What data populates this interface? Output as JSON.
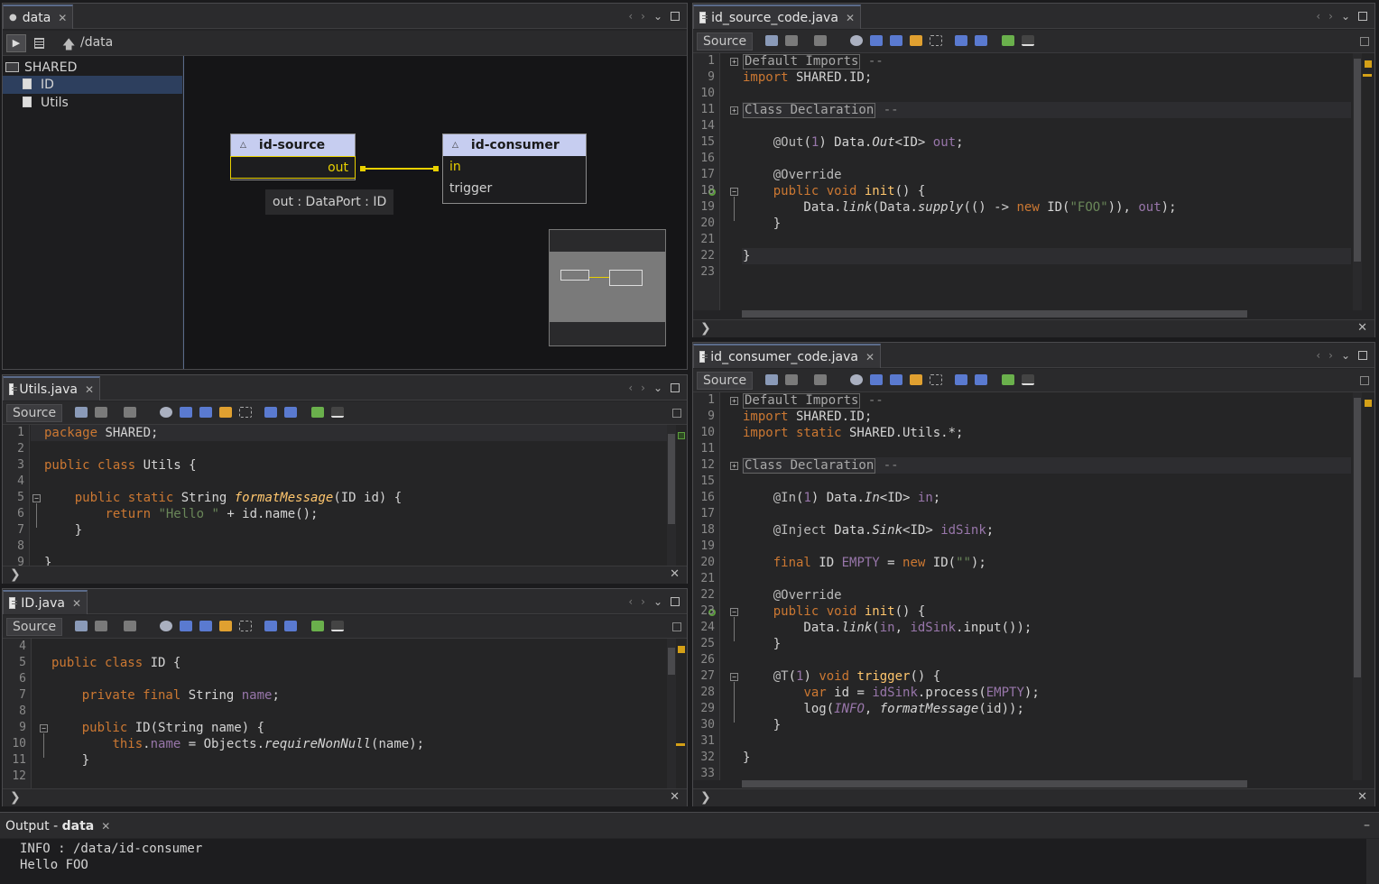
{
  "data_panel": {
    "tab_label": "data",
    "breadcrumb": "/data",
    "tree": {
      "root": "SHARED",
      "items": [
        "ID",
        "Utils"
      ]
    },
    "graph": {
      "source_node": {
        "title": "id-source",
        "ports": [
          "out"
        ]
      },
      "consumer_node": {
        "title": "id-consumer",
        "ports": [
          "in",
          "trigger"
        ]
      },
      "tooltip": "out : DataPort : ID"
    }
  },
  "utils_editor": {
    "tab_label": "Utils.java",
    "source_label": "Source",
    "lines": [
      {
        "n": "1",
        "html": "<span class=\"kw\">package</span> SHARED;"
      },
      {
        "n": "2",
        "html": ""
      },
      {
        "n": "3",
        "html": "<span class=\"kw\">public class</span> Utils {"
      },
      {
        "n": "4",
        "html": ""
      },
      {
        "n": "5",
        "html": "    <span class=\"kw\">public static</span> String <span class=\"fn\">formatMessage</span>(ID id) {"
      },
      {
        "n": "6",
        "html": "        <span class=\"kw\">return</span> <span class=\"str\">\"Hello \"</span> + id.name();"
      },
      {
        "n": "7",
        "html": "    }"
      },
      {
        "n": "8",
        "html": ""
      },
      {
        "n": "9",
        "html": "}"
      }
    ]
  },
  "id_editor": {
    "tab_label": "ID.java",
    "source_label": "Source",
    "lines": [
      {
        "n": "4",
        "html": ""
      },
      {
        "n": "5",
        "html": "<span class=\"kw\">public class</span> ID {"
      },
      {
        "n": "6",
        "html": ""
      },
      {
        "n": "7",
        "html": "    <span class=\"kw\">private final</span> String <span class=\"fld\">name</span>;"
      },
      {
        "n": "8",
        "html": ""
      },
      {
        "n": "9",
        "html": "    <span class=\"kw\">public</span> ID(String name) {"
      },
      {
        "n": "10",
        "html": "        <span class=\"kw\">this</span>.<span class=\"fld\">name</span> = Objects.<span class=\"it\">requireNonNull</span>(name);"
      },
      {
        "n": "11",
        "html": "    }"
      },
      {
        "n": "12",
        "html": ""
      }
    ]
  },
  "source_editor": {
    "tab_label": "id_source_code.java",
    "source_label": "Source",
    "lines": [
      {
        "n": "1",
        "html": "<span class=\"foldbox\">Default Imports</span> <span class=\"gray\">--</span>"
      },
      {
        "n": "9",
        "html": "<span class=\"kw\">import</span> SHARED.ID;"
      },
      {
        "n": "10",
        "html": ""
      },
      {
        "n": "11",
        "html": "<span class=\"foldbox\">Class Declaration</span> <span class=\"gray\">--</span>"
      },
      {
        "n": "14",
        "html": ""
      },
      {
        "n": "15",
        "html": "    <span class=\"ann\">@Out</span>(<span class=\"fld\">1</span>) Data.<span class=\"it\">Out</span>&lt;ID&gt; <span class=\"fld\">out</span>;"
      },
      {
        "n": "16",
        "html": ""
      },
      {
        "n": "17",
        "html": "    <span class=\"ann\">@Override</span>"
      },
      {
        "n": "18",
        "html": "    <span class=\"kw\">public void</span> <span class=\"fn\" style=\"font-style:normal\">init</span>() {"
      },
      {
        "n": "19",
        "html": "        Data.<span class=\"it\">link</span>(Data.<span class=\"it\">supply</span>(() -&gt; <span class=\"kw\">new</span> ID(<span class=\"str\">\"FOO\"</span>)), <span class=\"fld\">out</span>);"
      },
      {
        "n": "20",
        "html": "    }"
      },
      {
        "n": "21",
        "html": ""
      },
      {
        "n": "22",
        "html": "}"
      },
      {
        "n": "23",
        "html": ""
      }
    ]
  },
  "consumer_editor": {
    "tab_label": "id_consumer_code.java",
    "source_label": "Source",
    "lines": [
      {
        "n": "1",
        "html": "<span class=\"foldbox\">Default Imports</span> <span class=\"gray\">--</span>"
      },
      {
        "n": "9",
        "html": "<span class=\"kw\">import</span> SHARED.ID;"
      },
      {
        "n": "10",
        "html": "<span class=\"kw\">import static</span> SHARED.Utils.*;"
      },
      {
        "n": "11",
        "html": ""
      },
      {
        "n": "12",
        "html": "<span class=\"foldbox\">Class Declaration</span> <span class=\"gray\">--</span>"
      },
      {
        "n": "15",
        "html": ""
      },
      {
        "n": "16",
        "html": "    <span class=\"ann\">@In</span>(<span class=\"fld\">1</span>) Data.<span class=\"it\">In</span>&lt;ID&gt; <span class=\"fld\">in</span>;"
      },
      {
        "n": "17",
        "html": ""
      },
      {
        "n": "18",
        "html": "    <span class=\"ann\">@Inject</span> Data.<span class=\"it\">Sink</span>&lt;ID&gt; <span class=\"fld\">idSink</span>;"
      },
      {
        "n": "19",
        "html": ""
      },
      {
        "n": "20",
        "html": "    <span class=\"kw\">final</span> ID <span class=\"fld\">EMPTY</span> = <span class=\"kw\">new</span> ID(<span class=\"str\">\"\"</span>);"
      },
      {
        "n": "21",
        "html": ""
      },
      {
        "n": "22",
        "html": "    <span class=\"ann\">@Override</span>"
      },
      {
        "n": "23",
        "html": "    <span class=\"kw\">public void</span> <span class=\"fn\" style=\"font-style:normal\">init</span>() {"
      },
      {
        "n": "24",
        "html": "        Data.<span class=\"it\">link</span>(<span class=\"fld\">in</span>, <span class=\"fld\">idSink</span>.input());"
      },
      {
        "n": "25",
        "html": "    }"
      },
      {
        "n": "26",
        "html": ""
      },
      {
        "n": "27",
        "html": "    <span class=\"ann\">@T</span>(<span class=\"fld\">1</span>) <span class=\"kw\">void</span> <span class=\"fn\" style=\"font-style:normal\">trigger</span>() {"
      },
      {
        "n": "28",
        "html": "        <span class=\"kw\">var</span> id = <span class=\"fld\">idSink</span>.process(<span class=\"fld\">EMPTY</span>);"
      },
      {
        "n": "29",
        "html": "        log(<span class=\"fld it\">INFO</span>, <span class=\"it\">formatMessage</span>(id));"
      },
      {
        "n": "30",
        "html": "    }"
      },
      {
        "n": "31",
        "html": ""
      },
      {
        "n": "32",
        "html": "}"
      },
      {
        "n": "33",
        "html": ""
      }
    ]
  },
  "output": {
    "tab_prefix": "Output - ",
    "tab_bold": "data",
    "lines": [
      "INFO : /data/id-consumer",
      "Hello FOO"
    ]
  }
}
